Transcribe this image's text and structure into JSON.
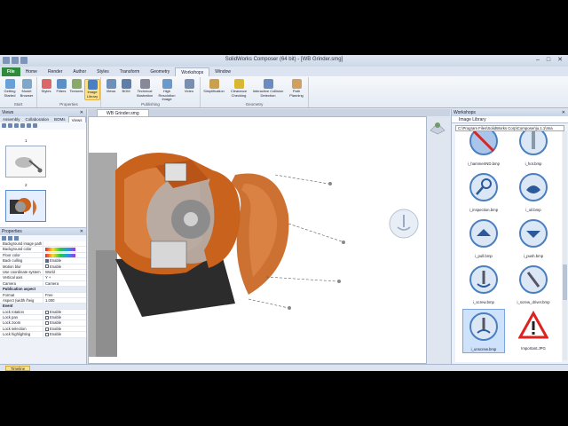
{
  "window": {
    "title": "SolidWorks Composer (64 bit) - [WB Grinder.smg]"
  },
  "ribbon_tabs": [
    "File",
    "Home",
    "Render",
    "Author",
    "Styles",
    "Transform",
    "Geometry",
    "Workshops",
    "Window"
  ],
  "ribbon_groups": [
    {
      "label": "Start",
      "buttons": [
        "Getting Started",
        "Model Browser"
      ]
    },
    {
      "label": "Properties",
      "buttons": [
        "Styles",
        "Filters",
        "Textures",
        "Image Library"
      ]
    },
    {
      "label": "Publishing",
      "buttons": [
        "Views",
        "BOM",
        "Technical Illustration",
        "High Resolution Image",
        "Video"
      ]
    },
    {
      "label": "Geometry",
      "buttons": [
        "Simplification",
        "Clearance Checking",
        "Interactive Collision Detection",
        "Path Planning"
      ]
    }
  ],
  "left_panel": {
    "title": "Views",
    "tabs": [
      "Assembly",
      "Collaboration",
      "BOMs",
      "Views"
    ],
    "views": [
      {
        "number": "1"
      },
      {
        "number": "2"
      }
    ]
  },
  "properties": {
    "title": "Properties",
    "rows": [
      {
        "key": "Background image path",
        "value": ""
      },
      {
        "key": "Background color",
        "value": ""
      },
      {
        "key": "Floor color",
        "value": ""
      },
      {
        "key": "Back culling",
        "value": "Enable"
      },
      {
        "key": "Motion blur",
        "value": "Enable"
      },
      {
        "key": "Use coordinate system",
        "value": "World"
      },
      {
        "key": "Vertical axis",
        "value": "Y +"
      },
      {
        "key": "Camera",
        "value": "Camera"
      },
      {
        "section": "Publication aspect"
      },
      {
        "key": "Format",
        "value": "Free"
      },
      {
        "key": "Aspect (width /heig",
        "value": "1.000"
      },
      {
        "section": "Event"
      },
      {
        "key": "Lock rotation",
        "value": "Enable"
      },
      {
        "key": "Lock pan",
        "value": "Enable"
      },
      {
        "key": "Lock zoom",
        "value": "Enable"
      },
      {
        "key": "Lock selection",
        "value": "Enable"
      },
      {
        "key": "Lock highlighting",
        "value": "Enable"
      }
    ]
  },
  "document": {
    "tab": "WB Grinder.smg"
  },
  "workshops": {
    "title": "Workshops",
    "tab": "Image Library",
    "path": "C:\\Program Files\\SolidWorks Corp\\Composer\\ju.1.1\\Ima"
  },
  "image_library": [
    {
      "name": "i_hammerIND.bmp",
      "icon": "hammer-no-icon"
    },
    {
      "name": "i_hot.bmp",
      "icon": "hot-icon"
    },
    {
      "name": "i_inspection.bmp",
      "icon": "inspection-icon"
    },
    {
      "name": "i_oil.bmp",
      "icon": "oil-icon"
    },
    {
      "name": "i_pull.bmp",
      "icon": "pull-icon"
    },
    {
      "name": "i_push.bmp",
      "icon": "push-icon"
    },
    {
      "name": "i_screw.bmp",
      "icon": "screw-icon"
    },
    {
      "name": "i_screw_driver.bmp",
      "icon": "screwdriver-icon"
    },
    {
      "name": "i_unscrew.bmp",
      "icon": "unscrew-icon"
    },
    {
      "name": "Important.JPG",
      "icon": "warning-icon"
    }
  ],
  "status": {
    "tab": "Timeline"
  },
  "colors": {
    "accent": "#fbe08a",
    "file_tab": "#2f8a3b",
    "part_copper": "#c8621c",
    "icon_blue": "#4a7fc1"
  }
}
